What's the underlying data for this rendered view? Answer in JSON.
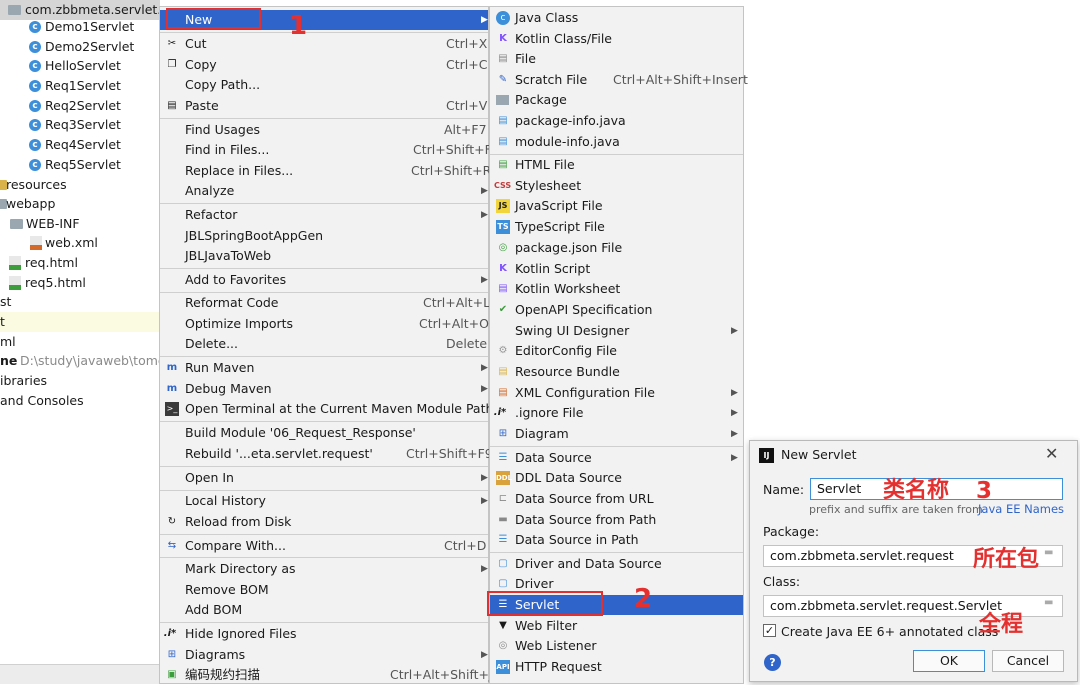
{
  "project_tree": {
    "package_header": "com.zbbmeta.servlet.request",
    "classes": [
      "Demo1Servlet",
      "Demo2Servlet",
      "HelloServlet",
      "Req1Servlet",
      "Req2Servlet",
      "Req3Servlet",
      "Req4Servlet",
      "Req5Servlet"
    ],
    "resources": "resources",
    "webapp": "webapp",
    "web_inf": "WEB-INF",
    "web_xml": "web.xml",
    "req_html": "req.html",
    "req5_html": "req5.html",
    "st_fragment": "st",
    "t_fragment": "t",
    "ml_fragment": "ml",
    "home_label": "ne",
    "home_path": "D:\\study\\javaweb\\tomca",
    "libraries": "ibraries",
    "consoles": "and Consoles"
  },
  "context_menu": {
    "items": [
      {
        "label": "New",
        "shortcut": "",
        "arrow": true
      },
      {
        "label": "Cut",
        "shortcut": "Ctrl+X",
        "icon": "cut-icon"
      },
      {
        "label": "Copy",
        "shortcut": "Ctrl+C",
        "icon": "copy-icon"
      },
      {
        "label": "Copy Path...",
        "shortcut": ""
      },
      {
        "label": "Paste",
        "shortcut": "Ctrl+V",
        "icon": "paste-icon"
      },
      {
        "label": "Find Usages",
        "shortcut": "Alt+F7"
      },
      {
        "label": "Find in Files...",
        "shortcut": "Ctrl+Shift+F"
      },
      {
        "label": "Replace in Files...",
        "shortcut": "Ctrl+Shift+R"
      },
      {
        "label": "Analyze",
        "shortcut": "",
        "arrow": true
      },
      {
        "label": "Refactor",
        "shortcut": "",
        "arrow": true
      },
      {
        "label": "JBLSpringBootAppGen",
        "shortcut": ""
      },
      {
        "label": "JBLJavaToWeb",
        "shortcut": ""
      },
      {
        "label": "Add to Favorites",
        "shortcut": "",
        "arrow": true
      },
      {
        "label": "Reformat Code",
        "shortcut": "Ctrl+Alt+L"
      },
      {
        "label": "Optimize Imports",
        "shortcut": "Ctrl+Alt+O"
      },
      {
        "label": "Delete...",
        "shortcut": "Delete"
      },
      {
        "label": "Run Maven",
        "shortcut": "",
        "arrow": true
      },
      {
        "label": "Debug Maven",
        "shortcut": "",
        "arrow": true
      },
      {
        "label": "Open Terminal at the Current Maven Module Path",
        "shortcut": ""
      },
      {
        "label": "Build Module '06_Request_Response'",
        "shortcut": ""
      },
      {
        "label": "Rebuild '...eta.servlet.request'",
        "shortcut": "Ctrl+Shift+F9"
      },
      {
        "label": "Open In",
        "shortcut": "",
        "arrow": true
      },
      {
        "label": "Local History",
        "shortcut": "",
        "arrow": true
      },
      {
        "label": "Reload from Disk",
        "shortcut": ""
      },
      {
        "label": "Compare With...",
        "shortcut": "Ctrl+D"
      },
      {
        "label": "Mark Directory as",
        "shortcut": "",
        "arrow": true
      },
      {
        "label": "Remove BOM",
        "shortcut": ""
      },
      {
        "label": "Add BOM",
        "shortcut": ""
      },
      {
        "label": "Hide Ignored Files",
        "shortcut": ""
      },
      {
        "label": "Diagrams",
        "shortcut": "",
        "arrow": true
      },
      {
        "label": "编码规约扫描",
        "shortcut": "Ctrl+Alt+Shift+J"
      }
    ]
  },
  "new_submenu": {
    "items": [
      {
        "label": "Java Class",
        "shortcut": ""
      },
      {
        "label": "Kotlin Class/File",
        "shortcut": ""
      },
      {
        "label": "File",
        "shortcut": ""
      },
      {
        "label": "Scratch File",
        "shortcut": "Ctrl+Alt+Shift+Insert"
      },
      {
        "label": "Package",
        "shortcut": ""
      },
      {
        "label": "package-info.java",
        "shortcut": ""
      },
      {
        "label": "module-info.java",
        "shortcut": ""
      },
      {
        "label": "HTML File",
        "shortcut": ""
      },
      {
        "label": "Stylesheet",
        "shortcut": ""
      },
      {
        "label": "JavaScript File",
        "shortcut": ""
      },
      {
        "label": "TypeScript File",
        "shortcut": ""
      },
      {
        "label": "package.json File",
        "shortcut": ""
      },
      {
        "label": "Kotlin Script",
        "shortcut": ""
      },
      {
        "label": "Kotlin Worksheet",
        "shortcut": ""
      },
      {
        "label": "OpenAPI Specification",
        "shortcut": ""
      },
      {
        "label": "Swing UI Designer",
        "shortcut": "",
        "arrow": true
      },
      {
        "label": "EditorConfig File",
        "shortcut": ""
      },
      {
        "label": "Resource Bundle",
        "shortcut": ""
      },
      {
        "label": "XML Configuration File",
        "shortcut": "",
        "arrow": true
      },
      {
        "label": ".ignore File",
        "shortcut": "",
        "arrow": true
      },
      {
        "label": "Diagram",
        "shortcut": "",
        "arrow": true
      },
      {
        "label": "Data Source",
        "shortcut": "",
        "arrow": true
      },
      {
        "label": "DDL Data Source",
        "shortcut": ""
      },
      {
        "label": "Data Source from URL",
        "shortcut": ""
      },
      {
        "label": "Data Source from Path",
        "shortcut": ""
      },
      {
        "label": "Data Source in Path",
        "shortcut": ""
      },
      {
        "label": "Driver and Data Source",
        "shortcut": ""
      },
      {
        "label": "Driver",
        "shortcut": ""
      },
      {
        "label": "Servlet",
        "shortcut": ""
      },
      {
        "label": "Web Filter",
        "shortcut": ""
      },
      {
        "label": "Web Listener",
        "shortcut": ""
      },
      {
        "label": "HTTP Request",
        "shortcut": ""
      }
    ]
  },
  "dialog": {
    "title": "New Servlet",
    "name_label": "Name:",
    "name_value": "Servlet",
    "hint": "prefix and suffix are taken from",
    "hint_link": "Java EE Names",
    "package_label": "Package:",
    "package_value": "com.zbbmeta.servlet.request",
    "class_label": "Class:",
    "class_value": "com.zbbmeta.servlet.request.Servlet",
    "checkbox_label": "Create Java EE 6+ annotated class",
    "checkbox_checked": true,
    "ok": "OK",
    "cancel": "Cancel",
    "help": "?"
  },
  "annotations": {
    "n1": "1",
    "n2": "2",
    "n3": "3",
    "class_name": "类名称",
    "package_cn": "所在包",
    "full_path": "全程"
  },
  "colors": {
    "selection": "#2f65ca",
    "annotation": "#e53030",
    "menu_bg": "#f2f2f2",
    "link": "#2f65ca"
  }
}
